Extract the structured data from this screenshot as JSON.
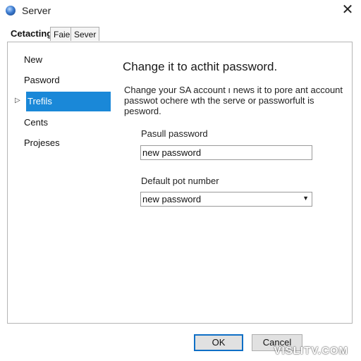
{
  "window": {
    "title": "Server",
    "icon": "server-globe-icon",
    "close_glyph": "✕"
  },
  "tabs": [
    {
      "label": "Cetacting"
    },
    {
      "label": "Faie"
    },
    {
      "label": "Sever"
    }
  ],
  "sidebar": {
    "items": [
      {
        "label": "New"
      },
      {
        "label": "Pasword"
      },
      {
        "label": "Trefils"
      },
      {
        "label": "Cents"
      },
      {
        "label": "Projeses"
      }
    ],
    "selected_index": 2,
    "arrow_glyph": "▷"
  },
  "main": {
    "heading": "Change it to acthit password.",
    "description": "Change your SA account ı news it to pore ant account passwot ochere wth the serve or passworfult is pesword.",
    "password_label": "Pasull password",
    "password_value": "new password",
    "port_label": "Default pot number",
    "port_value": "new password",
    "dropdown_glyph": "▼"
  },
  "buttons": {
    "ok": "OK",
    "cancel": "Cancel"
  },
  "watermark": "VISLITV.COM",
  "colors": {
    "selection": "#1a88d8",
    "primary_border": "#0f6fc6"
  }
}
